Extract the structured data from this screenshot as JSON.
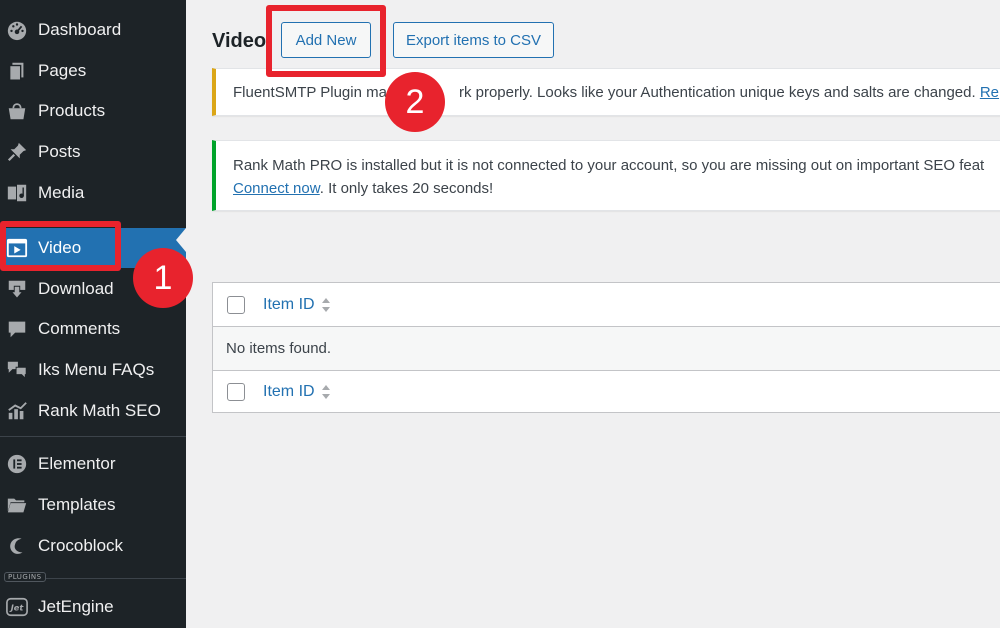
{
  "sidebar": {
    "items": [
      {
        "label": "Dashboard",
        "icon": "dashboard-icon"
      },
      {
        "label": "Pages",
        "icon": "pages-icon"
      },
      {
        "label": "Products",
        "icon": "products-icon"
      },
      {
        "label": "Posts",
        "icon": "pin-icon"
      },
      {
        "label": "Media",
        "icon": "media-icon"
      },
      {
        "label": "Video",
        "icon": "video-icon",
        "active": true
      },
      {
        "label": "Download",
        "icon": "download-icon"
      },
      {
        "label": "Comments",
        "icon": "comments-icon"
      },
      {
        "label": "Iks Menu FAQs",
        "icon": "faq-icon"
      },
      {
        "label": "Rank Math SEO",
        "icon": "rank-math-icon"
      },
      {
        "label": "Elementor",
        "icon": "elementor-icon"
      },
      {
        "label": "Templates",
        "icon": "folder-icon"
      },
      {
        "label": "Crocoblock",
        "icon": "crocoblock-icon"
      },
      {
        "label": "JetEngine",
        "icon": "jetengine-icon"
      }
    ],
    "plugins_tag": "PLUGINS"
  },
  "header": {
    "title": "Video",
    "add_new_label": "Add New",
    "export_label": "Export items to CSV"
  },
  "notices": {
    "fluent": {
      "text": "FluentSMTP Plugin ma",
      "text_after": "rk properly. Looks like your Authentication unique keys and salts are changed. ",
      "link": "Re"
    },
    "rankmath": {
      "line1": "Rank Math PRO is installed but it is not connected to your account, so you are missing out on important SEO feat",
      "link": "Connect now",
      "line2_rest": ". It only takes 20 seconds!"
    }
  },
  "table": {
    "column_header": "Item ID",
    "empty_message": "No items found."
  },
  "annotations": {
    "badge1": "1",
    "badge2": "2"
  },
  "colors": {
    "sidebar_bg": "#1d2327",
    "active_bg": "#2271b1",
    "link": "#2271b1",
    "highlight": "#e8232d",
    "notice_warning": "#dba617",
    "notice_success": "#00a32a"
  }
}
